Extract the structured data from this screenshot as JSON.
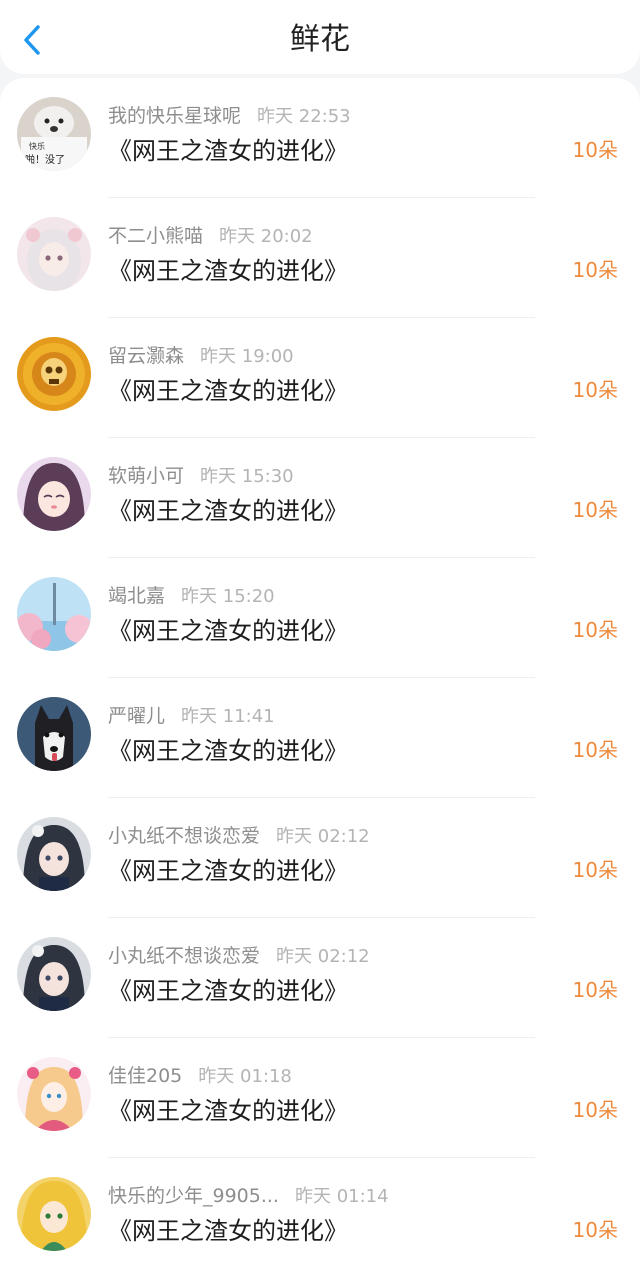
{
  "header": {
    "title": "鲜花",
    "back_icon": "chevron-left-icon",
    "accent_color": "#1e96f0"
  },
  "items": [
    {
      "user": "我的快乐星球呢",
      "time": "昨天 22:53",
      "book": "《网王之渣女的进化》",
      "count": "10朵",
      "avatar_icon": "dog-meme-avatar",
      "avatar_text": [
        "快乐",
        "啪！没了"
      ]
    },
    {
      "user": "不二小熊喵",
      "time": "昨天 20:02",
      "book": "《网王之渣女的进化》",
      "count": "10朵",
      "avatar_icon": "anime-girl-avatar"
    },
    {
      "user": "留云灏森",
      "time": "昨天 19:00",
      "book": "《网王之渣女的进化》",
      "count": "10朵",
      "avatar_icon": "golden-skull-avatar"
    },
    {
      "user": "软萌小可",
      "time": "昨天 15:30",
      "book": "《网王之渣女的进化》",
      "count": "10朵",
      "avatar_icon": "anime-girl-avatar"
    },
    {
      "user": "竭北嘉",
      "time": "昨天 15:20",
      "book": "《网王之渣女的进化》",
      "count": "10朵",
      "avatar_icon": "sakura-scene-avatar"
    },
    {
      "user": "严曜儿",
      "time": "昨天 11:41",
      "book": "《网王之渣女的进化》",
      "count": "10朵",
      "avatar_icon": "husky-avatar"
    },
    {
      "user": "小丸纸不想谈恋爱",
      "time": "昨天 02:12",
      "book": "《网王之渣女的进化》",
      "count": "10朵",
      "avatar_icon": "anime-girl-avatar"
    },
    {
      "user": "小丸纸不想谈恋爱",
      "time": "昨天 02:12",
      "book": "《网王之渣女的进化》",
      "count": "10朵",
      "avatar_icon": "anime-girl-avatar"
    },
    {
      "user": "佳佳205",
      "time": "昨天 01:18",
      "book": "《网王之渣女的进化》",
      "count": "10朵",
      "avatar_icon": "anime-girl-avatar"
    },
    {
      "user": "快乐的少年_9905...",
      "time": "昨天 01:14",
      "book": "《网王之渣女的进化》",
      "count": "10朵",
      "avatar_icon": "blonde-anime-avatar"
    }
  ],
  "colors": {
    "count": "#f08a3c",
    "user": "#8e8e8e",
    "time": "#b4b4b4",
    "book": "#1e1e1e"
  }
}
